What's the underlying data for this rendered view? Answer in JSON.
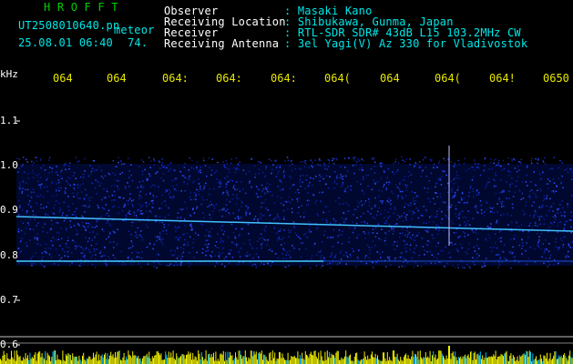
{
  "header": {
    "logo": "H R O F F T",
    "filename": "UT2508010640.pn",
    "meteor_label": "meteor",
    "datetime": "25.08.01 06:40",
    "count": "74.",
    "fields": [
      {
        "label": "Observer",
        "value": ": Masaki Kano"
      },
      {
        "label": "Receiving Location",
        "value": ": Shibukawa, Gunma, Japan"
      },
      {
        "label": "Receiver",
        "value": ": RTL-SDR SDR# 43dB L15 103.2MHz CW"
      },
      {
        "label": "Receiving Antenna",
        "value": ": 3el Yagi(V) Az 330 for Vladivostok"
      }
    ]
  },
  "axes": {
    "y_unit": "kHz",
    "y_ticks": [
      "1.1",
      "1.0",
      "0.9",
      "0.8",
      "0.7",
      "0.6"
    ],
    "x_ticks": [
      "064",
      "064",
      "064:",
      "064:",
      "064:",
      "064(",
      "064",
      "064(",
      "064!",
      "0650"
    ]
  },
  "colors": {
    "background": "#000000",
    "header_value": "#00e8e8",
    "header_label": "#ffffff",
    "logo": "#00d000",
    "tick": "#e8e800",
    "noise": "#1010a0",
    "echo": "#40c0ff"
  }
}
